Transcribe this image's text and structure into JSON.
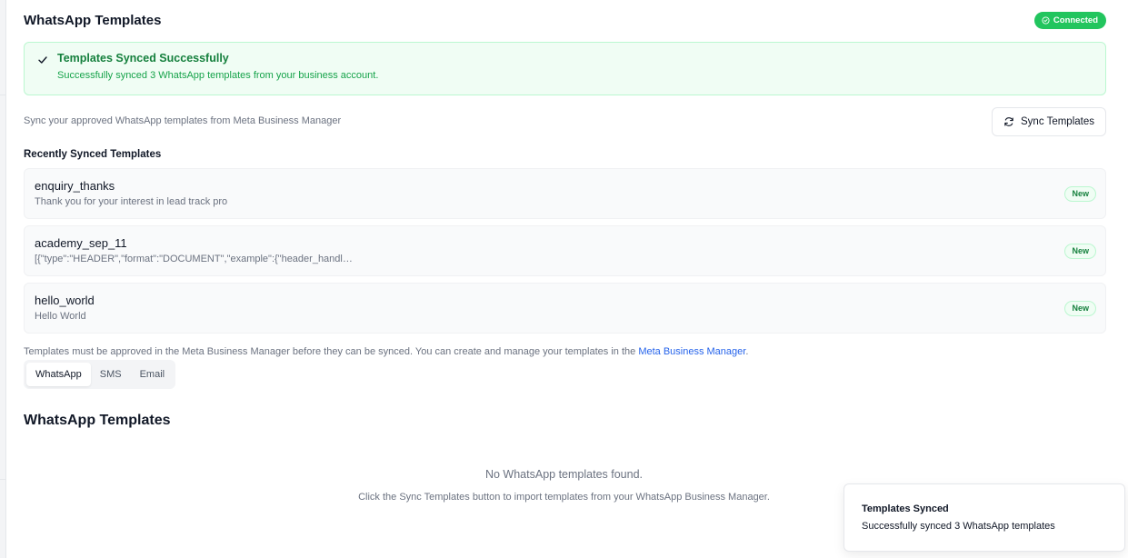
{
  "header": {
    "title": "WhatsApp Templates",
    "status_badge": "Connected",
    "status_color": "#22c55e"
  },
  "alert": {
    "title": "Templates Synced Successfully",
    "message": "Successfully synced 3 WhatsApp templates from your business account."
  },
  "sync": {
    "description": "Sync your approved WhatsApp templates from Meta Business Manager",
    "button_label": "Sync Templates"
  },
  "recent": {
    "heading": "Recently Synced Templates",
    "items": [
      {
        "name": "enquiry_thanks",
        "description": "Thank you for your interest in lead track pro",
        "badge": "New"
      },
      {
        "name": "academy_sep_11",
        "description": "[{\"type\":\"HEADER\",\"format\":\"DOCUMENT\",\"example\":{\"header_handl…",
        "badge": "New"
      },
      {
        "name": "hello_world",
        "description": "Hello World",
        "badge": "New"
      }
    ]
  },
  "note": {
    "text": "Templates must be approved in the Meta Business Manager before they can be synced. You can create and manage your templates in the ",
    "link": "Meta Business Manager",
    "suffix": "."
  },
  "tabs": [
    "WhatsApp",
    "SMS",
    "Email"
  ],
  "active_tab": "WhatsApp",
  "section": {
    "title": "WhatsApp Templates",
    "empty_title": "No WhatsApp templates found.",
    "empty_description": "Click the Sync Templates button to import templates from your WhatsApp Business Manager."
  },
  "toast": {
    "title": "Templates Synced",
    "message": "Successfully synced 3 WhatsApp templates"
  },
  "colors": {
    "success": "#16a34a",
    "link": "#2563eb"
  }
}
